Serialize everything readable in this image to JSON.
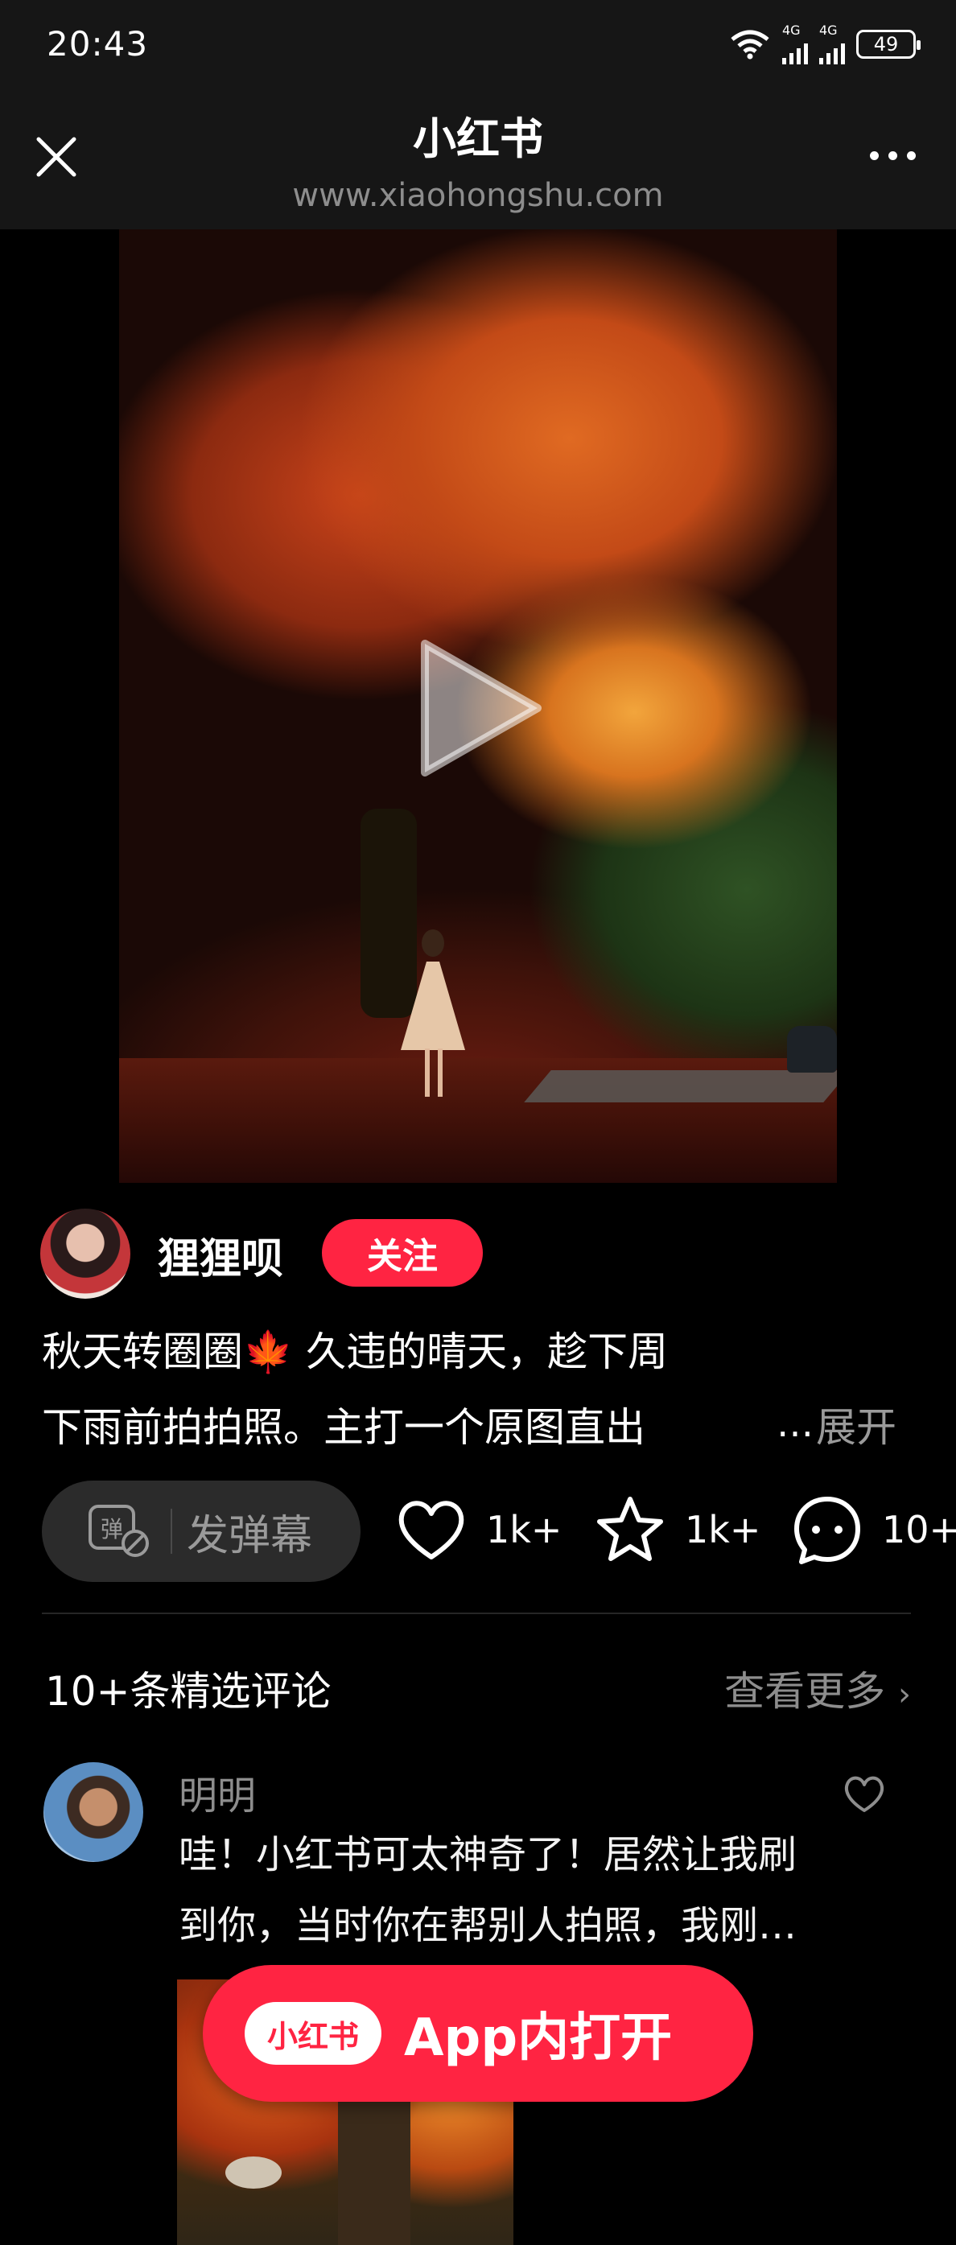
{
  "status_bar": {
    "time": "20:43",
    "signal1": "4G",
    "signal2": "4G",
    "battery": "49"
  },
  "nav": {
    "title": "小红书",
    "url": "www.xiaohongshu.com"
  },
  "author": {
    "name": "狸狸呗",
    "follow_label": "关注"
  },
  "description": {
    "line1": "秋天转圈圈",
    "line1_rest": " 久违的晴天，趁下周",
    "line2": "下雨前拍拍照。主打一个原图直出",
    "ellipsis": "…",
    "expand": "展开"
  },
  "actions": {
    "danmaku_icon_char": "弹",
    "danmaku_label": "发弹幕",
    "likes": "1k+",
    "collects": "1k+",
    "comments": "10+"
  },
  "comments": {
    "title": "10+条精选评论",
    "more": "查看更多",
    "items": [
      {
        "name": "明明",
        "line1": "哇！小红书可太神奇了！居然让我刷",
        "line2": "到你，当时你在帮别人拍照，我刚…"
      }
    ]
  },
  "open_app": {
    "logo": "小红书",
    "label": "App内打开"
  },
  "colors": {
    "brand": "#ff2442",
    "bar_bg": "#161616",
    "muted": "#8d8d8d"
  }
}
